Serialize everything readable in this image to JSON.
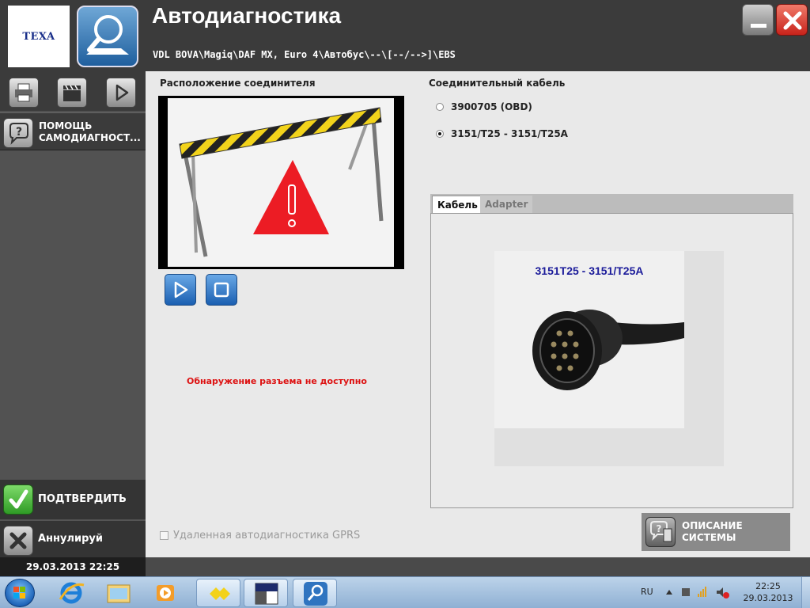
{
  "header": {
    "logo_text": "TEXA",
    "title": "Автодиагностика",
    "path": "VDL BOVA\\Magiq\\DAF MX, Euro 4\\Автобус\\--\\[--/-->]\\EBS"
  },
  "sidebar": {
    "help_label_line1": "ПОМОЩЬ",
    "help_label_line2": "САМОДИАГНОСТ...",
    "confirm_label": "ПОДТВЕРДИТЬ",
    "cancel_label": "Аннулируй",
    "datetime": "29.03.2013  22:25"
  },
  "main": {
    "connector_location_title": "Расположение соединителя",
    "detection_message": "Обнаружение разъема не доступно",
    "cable_section_title": "Соединительный кабель",
    "cable_options": [
      {
        "label": "3900705 (OBD)",
        "selected": false
      },
      {
        "label": "3151/T25 - 3151/T25A",
        "selected": true
      }
    ],
    "tabs": [
      {
        "label": "Кабель",
        "active": true
      },
      {
        "label": "Adapter",
        "active": false
      }
    ],
    "cable_image_caption": "3151T25 - 3151/T25A",
    "gprs_label": "Удаленная автодиагностика GPRS",
    "gprs_checked": false,
    "system_description_line1": "ОПИСАНИЕ",
    "system_description_line2": "СИСТЕМЫ"
  },
  "taskbar": {
    "language": "RU",
    "clock_time": "22:25",
    "clock_date": "29.03.2013"
  },
  "colors": {
    "header_bg": "#3b3b3b",
    "error_text": "#dd1111",
    "cable_caption": "#1b1b9a"
  }
}
